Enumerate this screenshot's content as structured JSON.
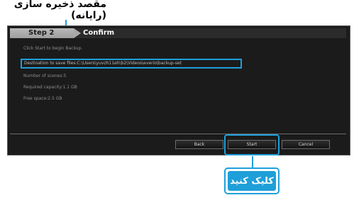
{
  "annotations": {
    "top_label": "مقصد ذخیره سازی (رایانه)",
    "bottom_label": "کلیک کنید"
  },
  "window": {
    "step": {
      "left_label": "Step 2",
      "current_label": "Confirm"
    },
    "lines": {
      "intro": "Click Start to begin Backup.",
      "destination": "Destination to save files:C:\\Users\\yuvzh11eh\\b2\\Videos\\everio\\backup-set",
      "num_files": "Number of scenes:5",
      "required_capacity": "Required capacity:1.1 GB",
      "free_space": "Free space:2.5 GB"
    },
    "buttons": {
      "back": "Back",
      "start": "Start",
      "cancel": "Cancel"
    }
  },
  "colors": {
    "callout": "#1ea0dc",
    "window_bg": "#1b1b1b"
  }
}
